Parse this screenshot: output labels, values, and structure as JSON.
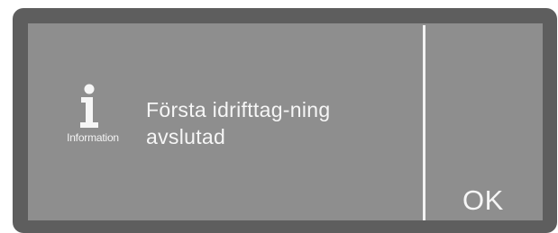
{
  "dialog": {
    "icon_name": "info-icon",
    "icon_caption": "Information",
    "message_lines": [
      "Första idrifttag-ning",
      "avslutad"
    ],
    "ok_label": "OK"
  },
  "colors": {
    "bezel": "#5e5e5e",
    "screen": "#8e8e8e",
    "text": "#f6f6f6"
  }
}
